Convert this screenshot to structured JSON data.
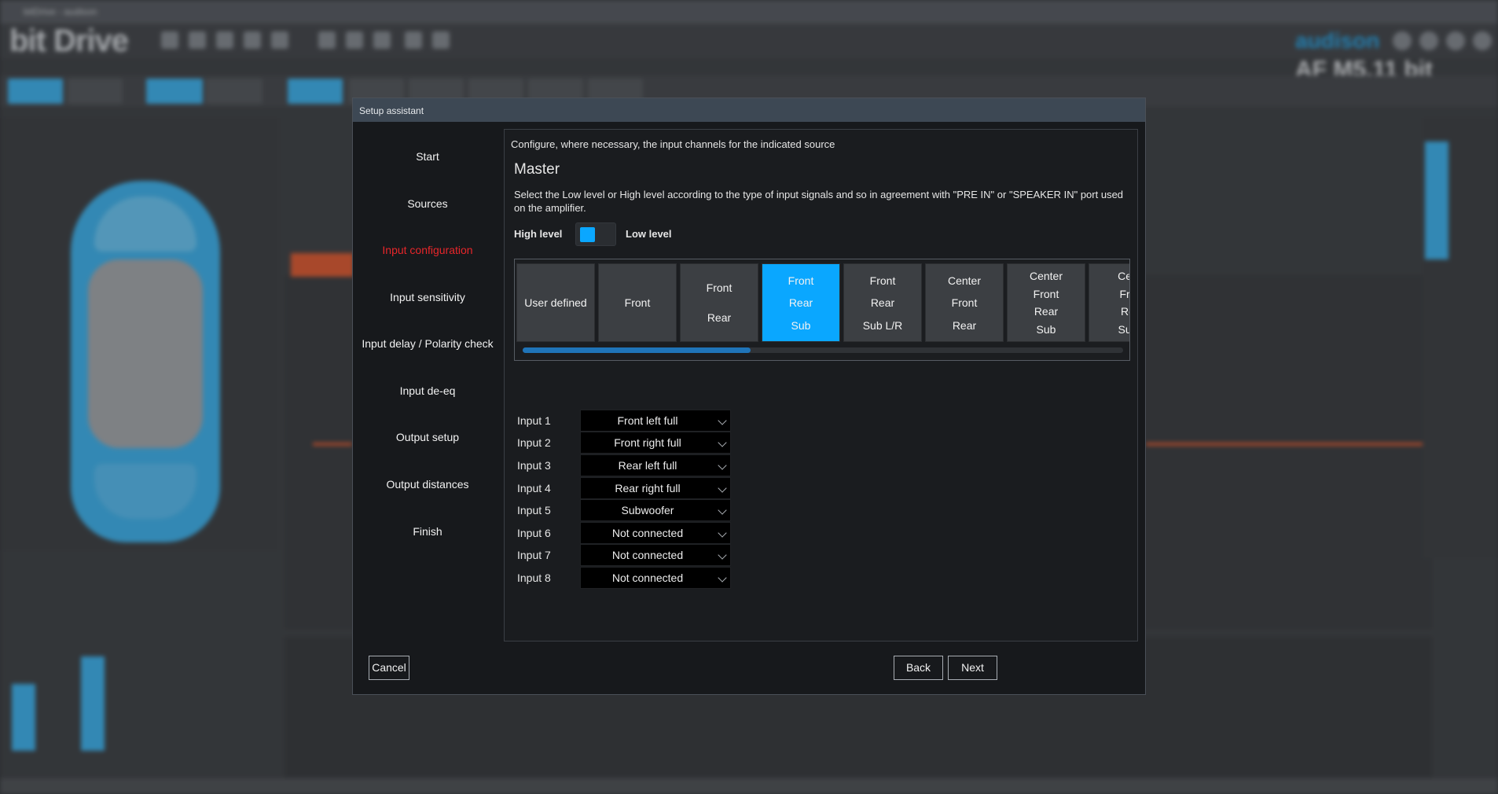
{
  "background_app": {
    "window_title": "bitDrive - audison",
    "logo": "bit Drive",
    "brand": "audison",
    "model": "AF M5.11 bit"
  },
  "dialog": {
    "title": "Setup assistant",
    "steps": [
      {
        "label": "Start",
        "active": false
      },
      {
        "label": "Sources",
        "active": false
      },
      {
        "label": "Input configuration",
        "active": true
      },
      {
        "label": "Input sensitivity",
        "active": false
      },
      {
        "label": "Input delay / Polarity check",
        "active": false
      },
      {
        "label": "Input de-eq",
        "active": false
      },
      {
        "label": "Output setup",
        "active": false
      },
      {
        "label": "Output distances",
        "active": false
      },
      {
        "label": "Finish",
        "active": false
      }
    ],
    "intro": "Configure, where necessary, the input channels for the indicated source",
    "source_title": "Master",
    "description": "Select the Low level or High level according to the type of input signals and so in agreement with \"PRE IN\" or \"SPEAKER IN\" port used on the amplifier.",
    "level_toggle": {
      "left_label": "High level",
      "right_label": "Low level",
      "selected": "High level"
    },
    "presets": [
      {
        "lines": [
          "User defined"
        ],
        "selected": false
      },
      {
        "lines": [
          "Front"
        ],
        "selected": false
      },
      {
        "lines": [
          "Front",
          "Rear"
        ],
        "selected": false
      },
      {
        "lines": [
          "Front",
          "Rear",
          "Sub"
        ],
        "selected": true
      },
      {
        "lines": [
          "Front",
          "Rear",
          "Sub L/R"
        ],
        "selected": false
      },
      {
        "lines": [
          "Center",
          "Front",
          "Rear"
        ],
        "selected": false
      },
      {
        "lines": [
          "Center",
          "Front",
          "Rear",
          "Sub"
        ],
        "selected": false
      },
      {
        "lines": [
          "Cen",
          "Fro",
          "Re",
          "Sub"
        ],
        "selected": false
      }
    ],
    "preset_scroll_fraction": 0.38,
    "inputs": [
      {
        "label": "Input 1",
        "value": "Front left full"
      },
      {
        "label": "Input 2",
        "value": "Front right full"
      },
      {
        "label": "Input 3",
        "value": "Rear left full"
      },
      {
        "label": "Input 4",
        "value": "Rear right full"
      },
      {
        "label": "Input 5",
        "value": "Subwoofer"
      },
      {
        "label": "Input 6",
        "value": "Not connected"
      },
      {
        "label": "Input 7",
        "value": "Not connected"
      },
      {
        "label": "Input 8",
        "value": "Not connected"
      }
    ],
    "buttons": {
      "cancel": "Cancel",
      "back": "Back",
      "next": "Next"
    },
    "colors": {
      "accent": "#0aa7ff",
      "active_step": "#e8262a"
    }
  }
}
